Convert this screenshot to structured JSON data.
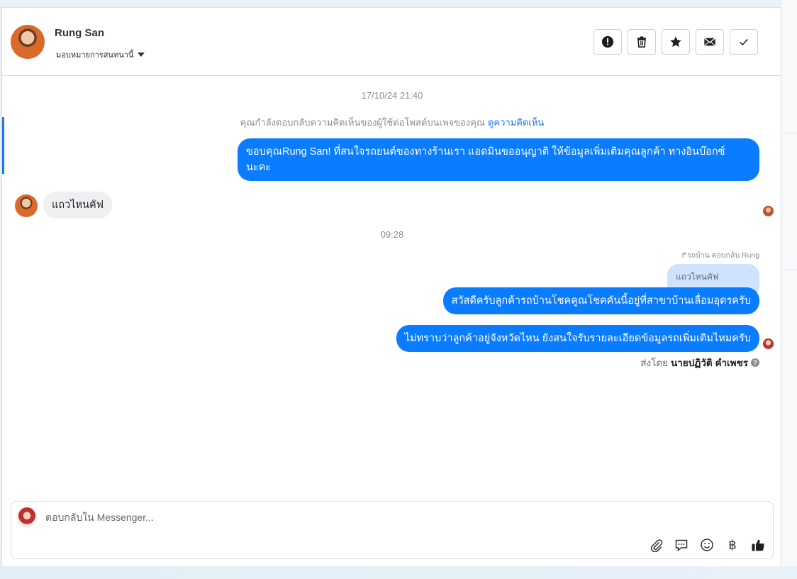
{
  "header": {
    "contact_name": "Rung San",
    "assign_label": "มอบหมายการสนทนานี้",
    "actions": [
      {
        "name": "spam-button",
        "icon": "alert-icon"
      },
      {
        "name": "delete-button",
        "icon": "trash-icon"
      },
      {
        "name": "star-button",
        "icon": "star-icon"
      },
      {
        "name": "unread-button",
        "icon": "envelope-icon"
      },
      {
        "name": "done-button",
        "icon": "check-icon"
      }
    ]
  },
  "thread": {
    "timestamp_1": "17/10/24 21:40",
    "notice_text": "คุณกำลังตอบกลับความคิดเห็นของผู้ใช้ต่อโพสต์บนเพจของคุณ",
    "notice_link": "ดูความคิดเห็น",
    "msg_out_1": "ขอบคุณRung San! ที่สนใจรถยนต์ของทางร้านเรา แอดมินขออนุญาติ ให้ข้อมูลเพิ่มเติมคุณลูกค้า ทางอินบ๊อกซ์ นะคะ",
    "msg_in_1": "แถวไหนคัฟ",
    "timestamp_2": "09:28",
    "reply_to_label": "รถบ้าน ตอบกลับ Rung",
    "quoted_text": "แถวไหนคัฟ",
    "msg_out_2": "สวัสดีครับลูกค้ารถบ้านโชคคูณโชคคันนี้อยู่ที่สาขาบ้านเลื่อมอุดรครับ",
    "msg_out_3": "ไม่ทราบว่าลูกค้าอยู่จังหวัดไหน ยังสนใจรับรายละเอียดข้อมูลรถเพิ่มเติมไหมครับ",
    "sent_by_prefix": "ส่งโดย",
    "sent_by_name": "นายปฏิวัติ คำเพชร"
  },
  "composer": {
    "placeholder": "ตอบกลับใน Messenger...",
    "value": "",
    "tools": [
      "attach-icon",
      "saved-reply-icon",
      "emoji-icon",
      "baht-icon",
      "like-icon"
    ],
    "baht_symbol": "฿"
  },
  "colors": {
    "accent": "#1877f2",
    "outgoing_bubble": "#0a7cff",
    "incoming_bubble": "#eef0f2",
    "quoted_bubble": "#cfe3ff"
  }
}
